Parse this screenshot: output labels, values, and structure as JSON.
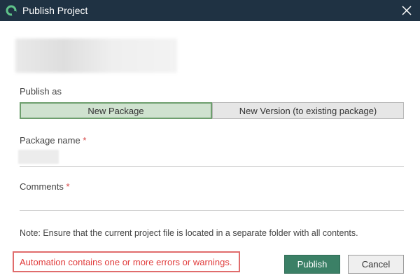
{
  "window": {
    "title": "Publish Project",
    "logo_icon": "app-logo-icon",
    "close_icon": "close-icon",
    "titlebar_color": "#1f3243"
  },
  "form": {
    "publish_as": {
      "label": "Publish as",
      "options": [
        "New Package",
        "New Version (to existing package)"
      ],
      "selected": "New Package"
    },
    "package_name": {
      "label": "Package name",
      "required_marker": "*"
    },
    "comments": {
      "label": "Comments",
      "required_marker": "*"
    },
    "note": "Note: Ensure that the current project file is located in a separate folder with all contents."
  },
  "footer": {
    "error_message": "Automation contains one or more errors or warnings.",
    "publish_label": "Publish",
    "cancel_label": "Cancel"
  },
  "colors": {
    "primary_button": "#3b8066",
    "selected_segment": "#cfe2cf",
    "error": "#e03c3c"
  }
}
